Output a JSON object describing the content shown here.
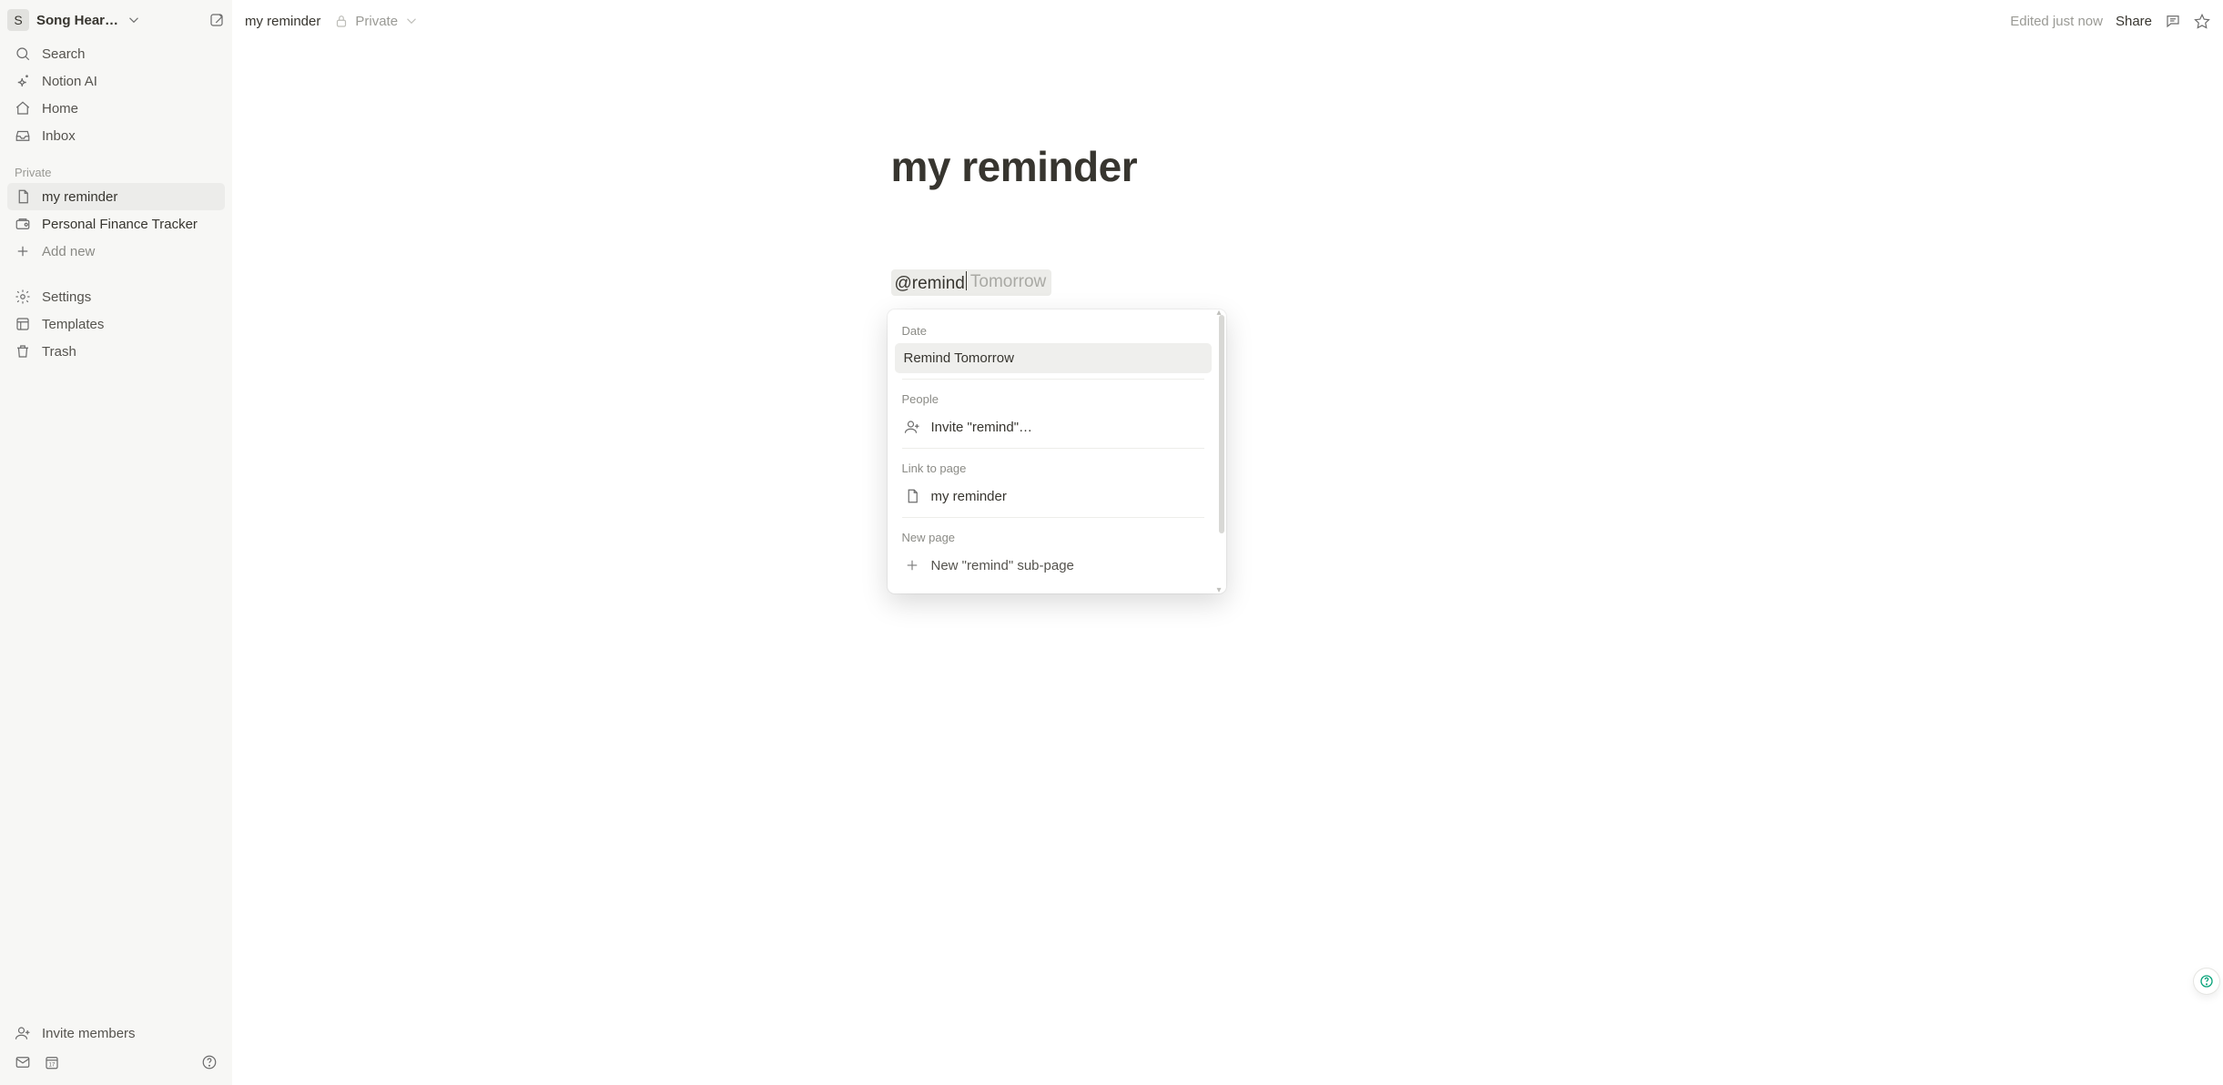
{
  "workspace": {
    "avatar_letter": "S",
    "name": "Song Hear…"
  },
  "sidebar": {
    "nav": {
      "search": "Search",
      "ai": "Notion AI",
      "home": "Home",
      "inbox": "Inbox"
    },
    "section_label": "Private",
    "pages": [
      {
        "title": "my reminder",
        "active": true
      },
      {
        "title": "Personal Finance Tracker",
        "active": false
      }
    ],
    "add_new": "Add new",
    "utils": {
      "settings": "Settings",
      "templates": "Templates",
      "trash": "Trash"
    },
    "invite_members": "Invite members"
  },
  "topbar": {
    "page_title": "my reminder",
    "privacy": "Private",
    "edited": "Edited just now",
    "share": "Share"
  },
  "doc": {
    "title": "my reminder",
    "mention_typed": "@remind",
    "mention_ghost": "Tomorrow"
  },
  "popup": {
    "groups": [
      {
        "label": "Date",
        "items": [
          {
            "label": "Remind Tomorrow",
            "icon": null,
            "selected": true
          }
        ]
      },
      {
        "label": "People",
        "items": [
          {
            "label": "Invite \"remind\"…",
            "icon": "person-add-icon",
            "selected": false
          }
        ]
      },
      {
        "label": "Link to page",
        "items": [
          {
            "label": "my reminder",
            "icon": "page-icon",
            "selected": false
          }
        ]
      },
      {
        "label": "New page",
        "items": [
          {
            "label": "New \"remind\" sub-page",
            "icon": "plus-icon",
            "selected": false,
            "cut": true
          }
        ]
      }
    ]
  }
}
